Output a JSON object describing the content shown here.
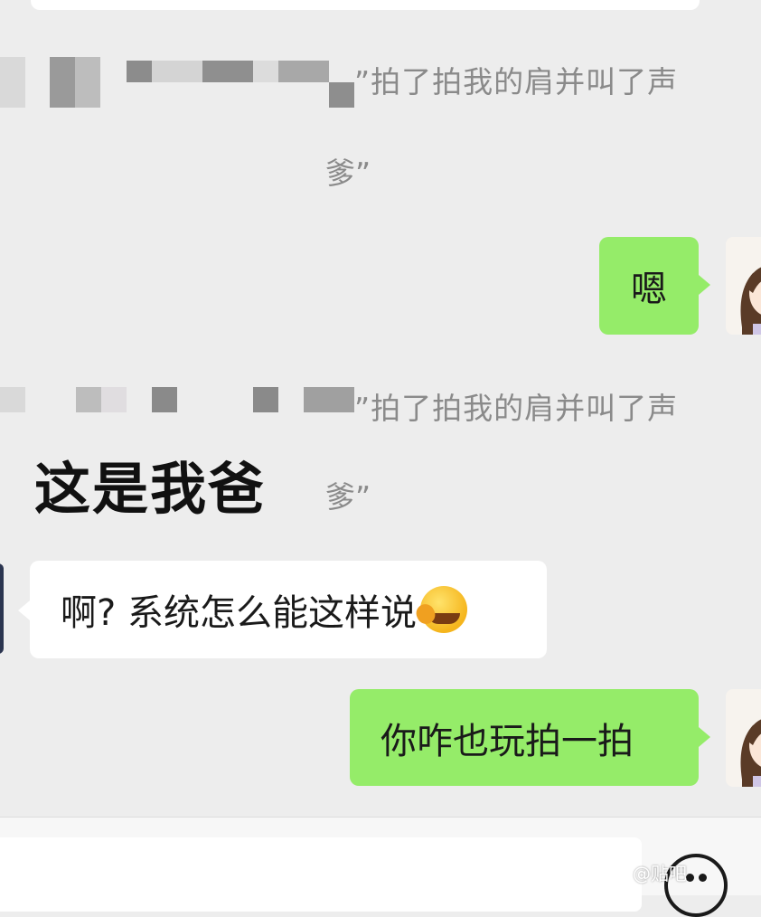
{
  "notice_top": {
    "line1": "”拍了拍我的肩并叫了声",
    "line2": "爹”"
  },
  "messages": [
    {
      "side": "right",
      "text": "嗯"
    },
    {
      "side": "left",
      "text": "啊? 系统怎么能这样说",
      "emoji": "facepalm-laughing-emoji"
    },
    {
      "side": "right",
      "text": "你咋也玩拍一拍"
    }
  ],
  "notice_bottom": {
    "line1": "”拍了拍我的肩并叫了声",
    "line2": "爹”"
  },
  "caption": "这是我爸",
  "input_bar": {
    "placeholder": "",
    "emoji_icon": "smiley-face-icon"
  },
  "watermark": "@贴吧",
  "colors": {
    "background": "#ededed",
    "my_bubble": "#95ec69",
    "their_bubble": "#ffffff",
    "notice_text": "#8a8a8a"
  }
}
